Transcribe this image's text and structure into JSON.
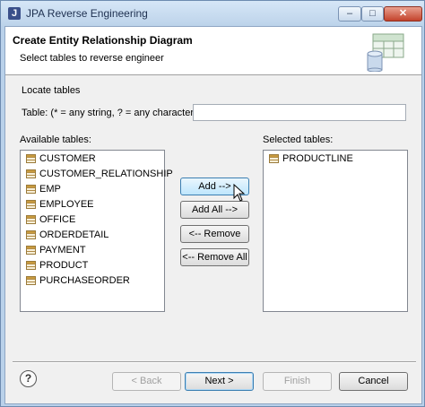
{
  "window": {
    "title": "JPA Reverse Engineering",
    "minimize": "–",
    "maximize": "□",
    "close": "✕"
  },
  "header": {
    "title": "Create Entity Relationship Diagram",
    "subtitle": "Select tables to reverse engineer"
  },
  "locate": {
    "group_title": "Locate tables",
    "label": "Table: (* = any string, ? = any character)",
    "value": ""
  },
  "available": {
    "label": "Available tables:",
    "items": [
      "CUSTOMER",
      "CUSTOMER_RELATIONSHIP",
      "EMP",
      "EMPLOYEE",
      "OFFICE",
      "ORDERDETAIL",
      "PAYMENT",
      "PRODUCT",
      "PURCHASEORDER"
    ]
  },
  "selected": {
    "label": "Selected tables:",
    "items": [
      "PRODUCTLINE"
    ]
  },
  "buttons": {
    "add": "Add -->",
    "add_all": "Add All -->",
    "remove": "<-- Remove",
    "remove_all": "<-- Remove All",
    "back": "< Back",
    "next": "Next >",
    "finish": "Finish",
    "cancel": "Cancel"
  },
  "icons": {
    "app": "jpa-app-icon",
    "header": "table-database-icon",
    "table": "table-icon",
    "help": "help-icon"
  },
  "colors": {
    "titlebar": "#bcd3ea",
    "close_button": "#c3432c",
    "hover_button": "#bee6fd",
    "dialog_bg": "#f0f0f0"
  }
}
